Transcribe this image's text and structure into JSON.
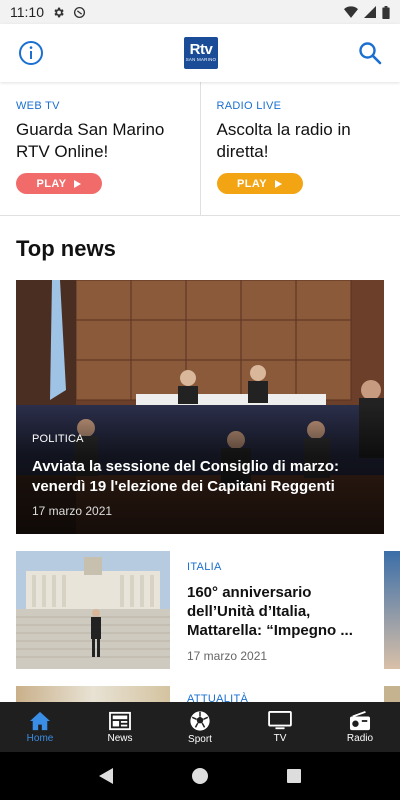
{
  "status_bar": {
    "time": "11:10"
  },
  "header": {
    "info_icon": "info-icon",
    "logo": {
      "text": "Rtv",
      "subtext": "SAN MARINO"
    },
    "search_icon": "search-icon"
  },
  "live": [
    {
      "kicker": "WEB TV",
      "title": "Guarda San Marino RTV Online!",
      "button": "PLAY",
      "button_color": "#f26b6b"
    },
    {
      "kicker": "RADIO LIVE",
      "title": "Ascolta la radio in diretta!",
      "button": "PLAY",
      "button_color": "#f2a413"
    }
  ],
  "top_news": {
    "title": "Top news",
    "hero": {
      "category": "POLITICA",
      "title": "Avviata la sessione del Consiglio di marzo: venerdì 19 l'elezione dei Capitani Reggenti",
      "date": "17 marzo 2021"
    },
    "items": [
      {
        "category": "ITALIA",
        "title": "160° anniversario dell’Unità d’Italia, Mattarella: “Impegno ...",
        "date": "17 marzo 2021"
      },
      {
        "category": "ATTUALITÀ"
      }
    ]
  },
  "bottom_nav": [
    {
      "label": "Home",
      "icon": "home-icon",
      "active": true
    },
    {
      "label": "News",
      "icon": "newspaper-icon",
      "active": false
    },
    {
      "label": "Sport",
      "icon": "soccer-ball-icon",
      "active": false
    },
    {
      "label": "TV",
      "icon": "tv-icon",
      "active": false
    },
    {
      "label": "Radio",
      "icon": "radio-icon",
      "active": false
    }
  ],
  "colors": {
    "accent": "#1a6fd0",
    "nav_active": "#3a8ee6",
    "nav_bg": "#1f1f1f",
    "logo_bg": "#1a4c98"
  }
}
